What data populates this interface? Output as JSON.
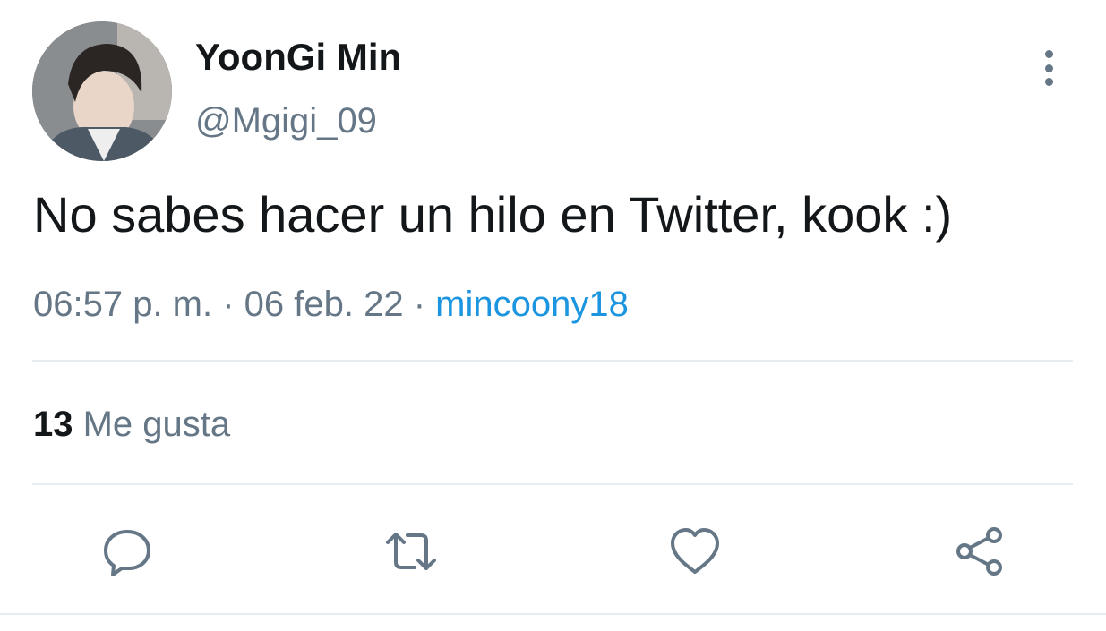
{
  "tweet": {
    "author_name": "YoonGi Min",
    "author_handle": "@Mgigi_09",
    "text": "No sabes hacer un hilo en Twitter, kook :)",
    "time": "06:57 p. m.",
    "sep1": " · ",
    "date": "06 feb. 22",
    "sep2": " · ",
    "source": "mincoony18",
    "likes_count": "13",
    "likes_label": " Me gusta"
  },
  "icons": {
    "more": "more-vertical-icon",
    "reply": "reply-icon",
    "retweet": "retweet-icon",
    "like": "heart-icon",
    "share": "share-icon"
  },
  "colors": {
    "primary_text": "#14171a",
    "secondary_text": "#657786",
    "link": "#1b95e0",
    "divider": "#e6ecf0"
  }
}
